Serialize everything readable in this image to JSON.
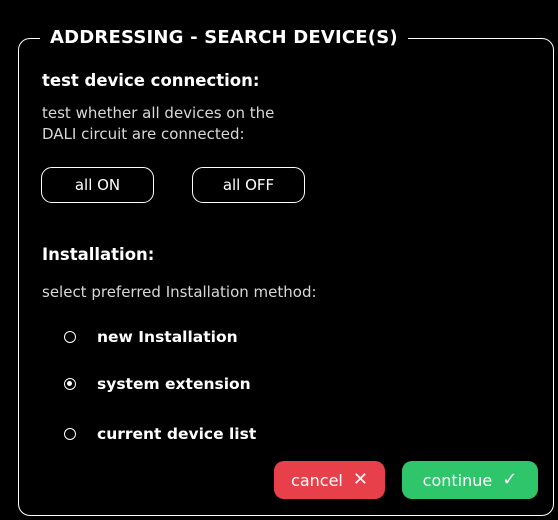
{
  "dialog": {
    "title": "ADDRESSING - SEARCH DEVICE(S)"
  },
  "test_section": {
    "heading": "test device connection:",
    "description_line1": "test whether all devices on the",
    "description_line2": "DALI circuit are connected:",
    "all_on_label": "all ON",
    "all_off_label": "all OFF"
  },
  "installation_section": {
    "heading": "Installation:",
    "description": "select preferred Installation method:",
    "options": [
      {
        "label": "new Installation",
        "selected": false
      },
      {
        "label": "system extension",
        "selected": true
      },
      {
        "label": "current device list",
        "selected": false
      }
    ]
  },
  "footer": {
    "cancel_label": "cancel",
    "cancel_icon": "close-icon",
    "cancel_color": "#e8404a",
    "continue_label": "continue",
    "continue_icon": "checkmark-icon",
    "continue_color": "#2ec56b"
  }
}
